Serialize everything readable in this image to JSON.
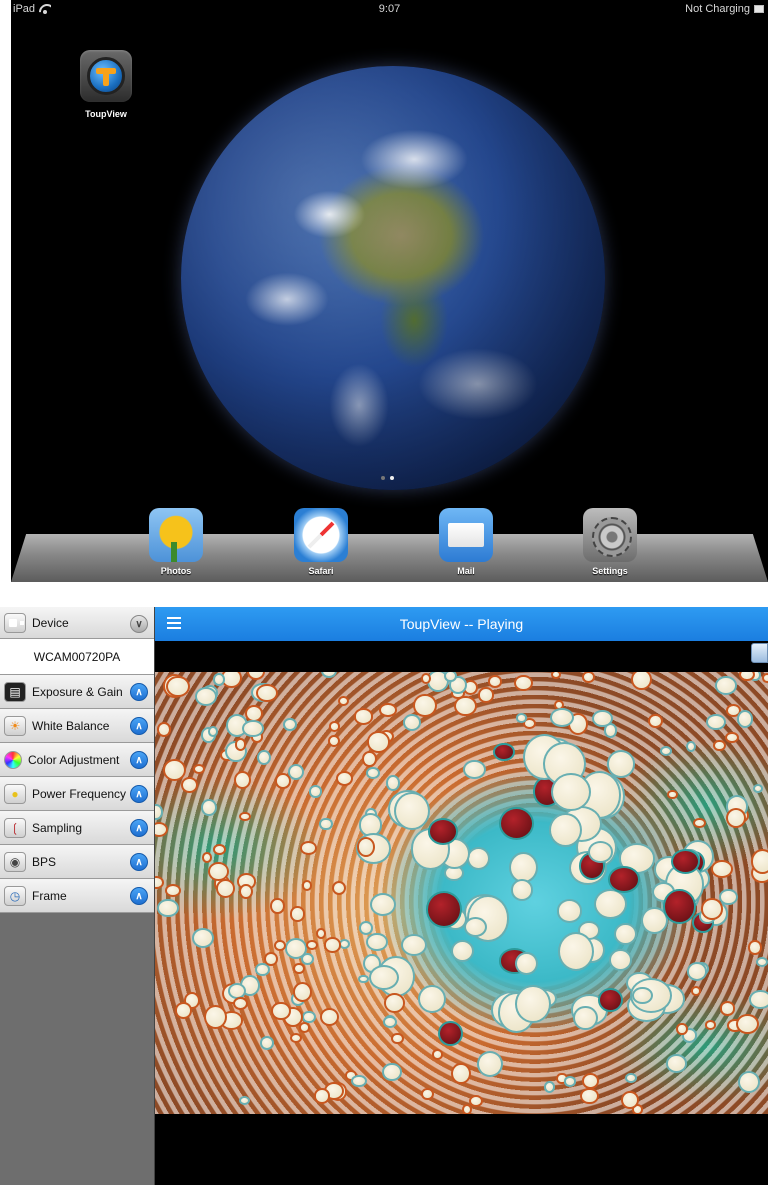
{
  "home_screen": {
    "status_bar": {
      "device": "iPad",
      "time": "9:07",
      "charging": "Not Charging"
    },
    "apps": [
      {
        "label": "ToupView"
      }
    ],
    "dock_apps": [
      {
        "label": "Photos"
      },
      {
        "label": "Safari"
      },
      {
        "label": "Mail"
      },
      {
        "label": "Settings"
      }
    ],
    "page_count": 2,
    "active_page": 2
  },
  "toupview": {
    "title": "ToupView -- Playing",
    "sidebar": {
      "device": {
        "label": "Device",
        "value": "WCAM00720PA"
      },
      "items": [
        {
          "label": "Exposure & Gain",
          "icon": "exposure-icon"
        },
        {
          "label": "White Balance",
          "icon": "sun-icon"
        },
        {
          "label": "Color Adjustment",
          "icon": "color-wheel-icon"
        },
        {
          "label": "Power Frequency",
          "icon": "bulb-icon"
        },
        {
          "label": "Sampling",
          "icon": "dropper-icon"
        },
        {
          "label": "BPS",
          "icon": "lens-icon"
        },
        {
          "label": "Frame",
          "icon": "clock-icon"
        }
      ]
    },
    "colors": {
      "topbar": "#1b7ee0",
      "accent": "#2e9bf2"
    }
  }
}
